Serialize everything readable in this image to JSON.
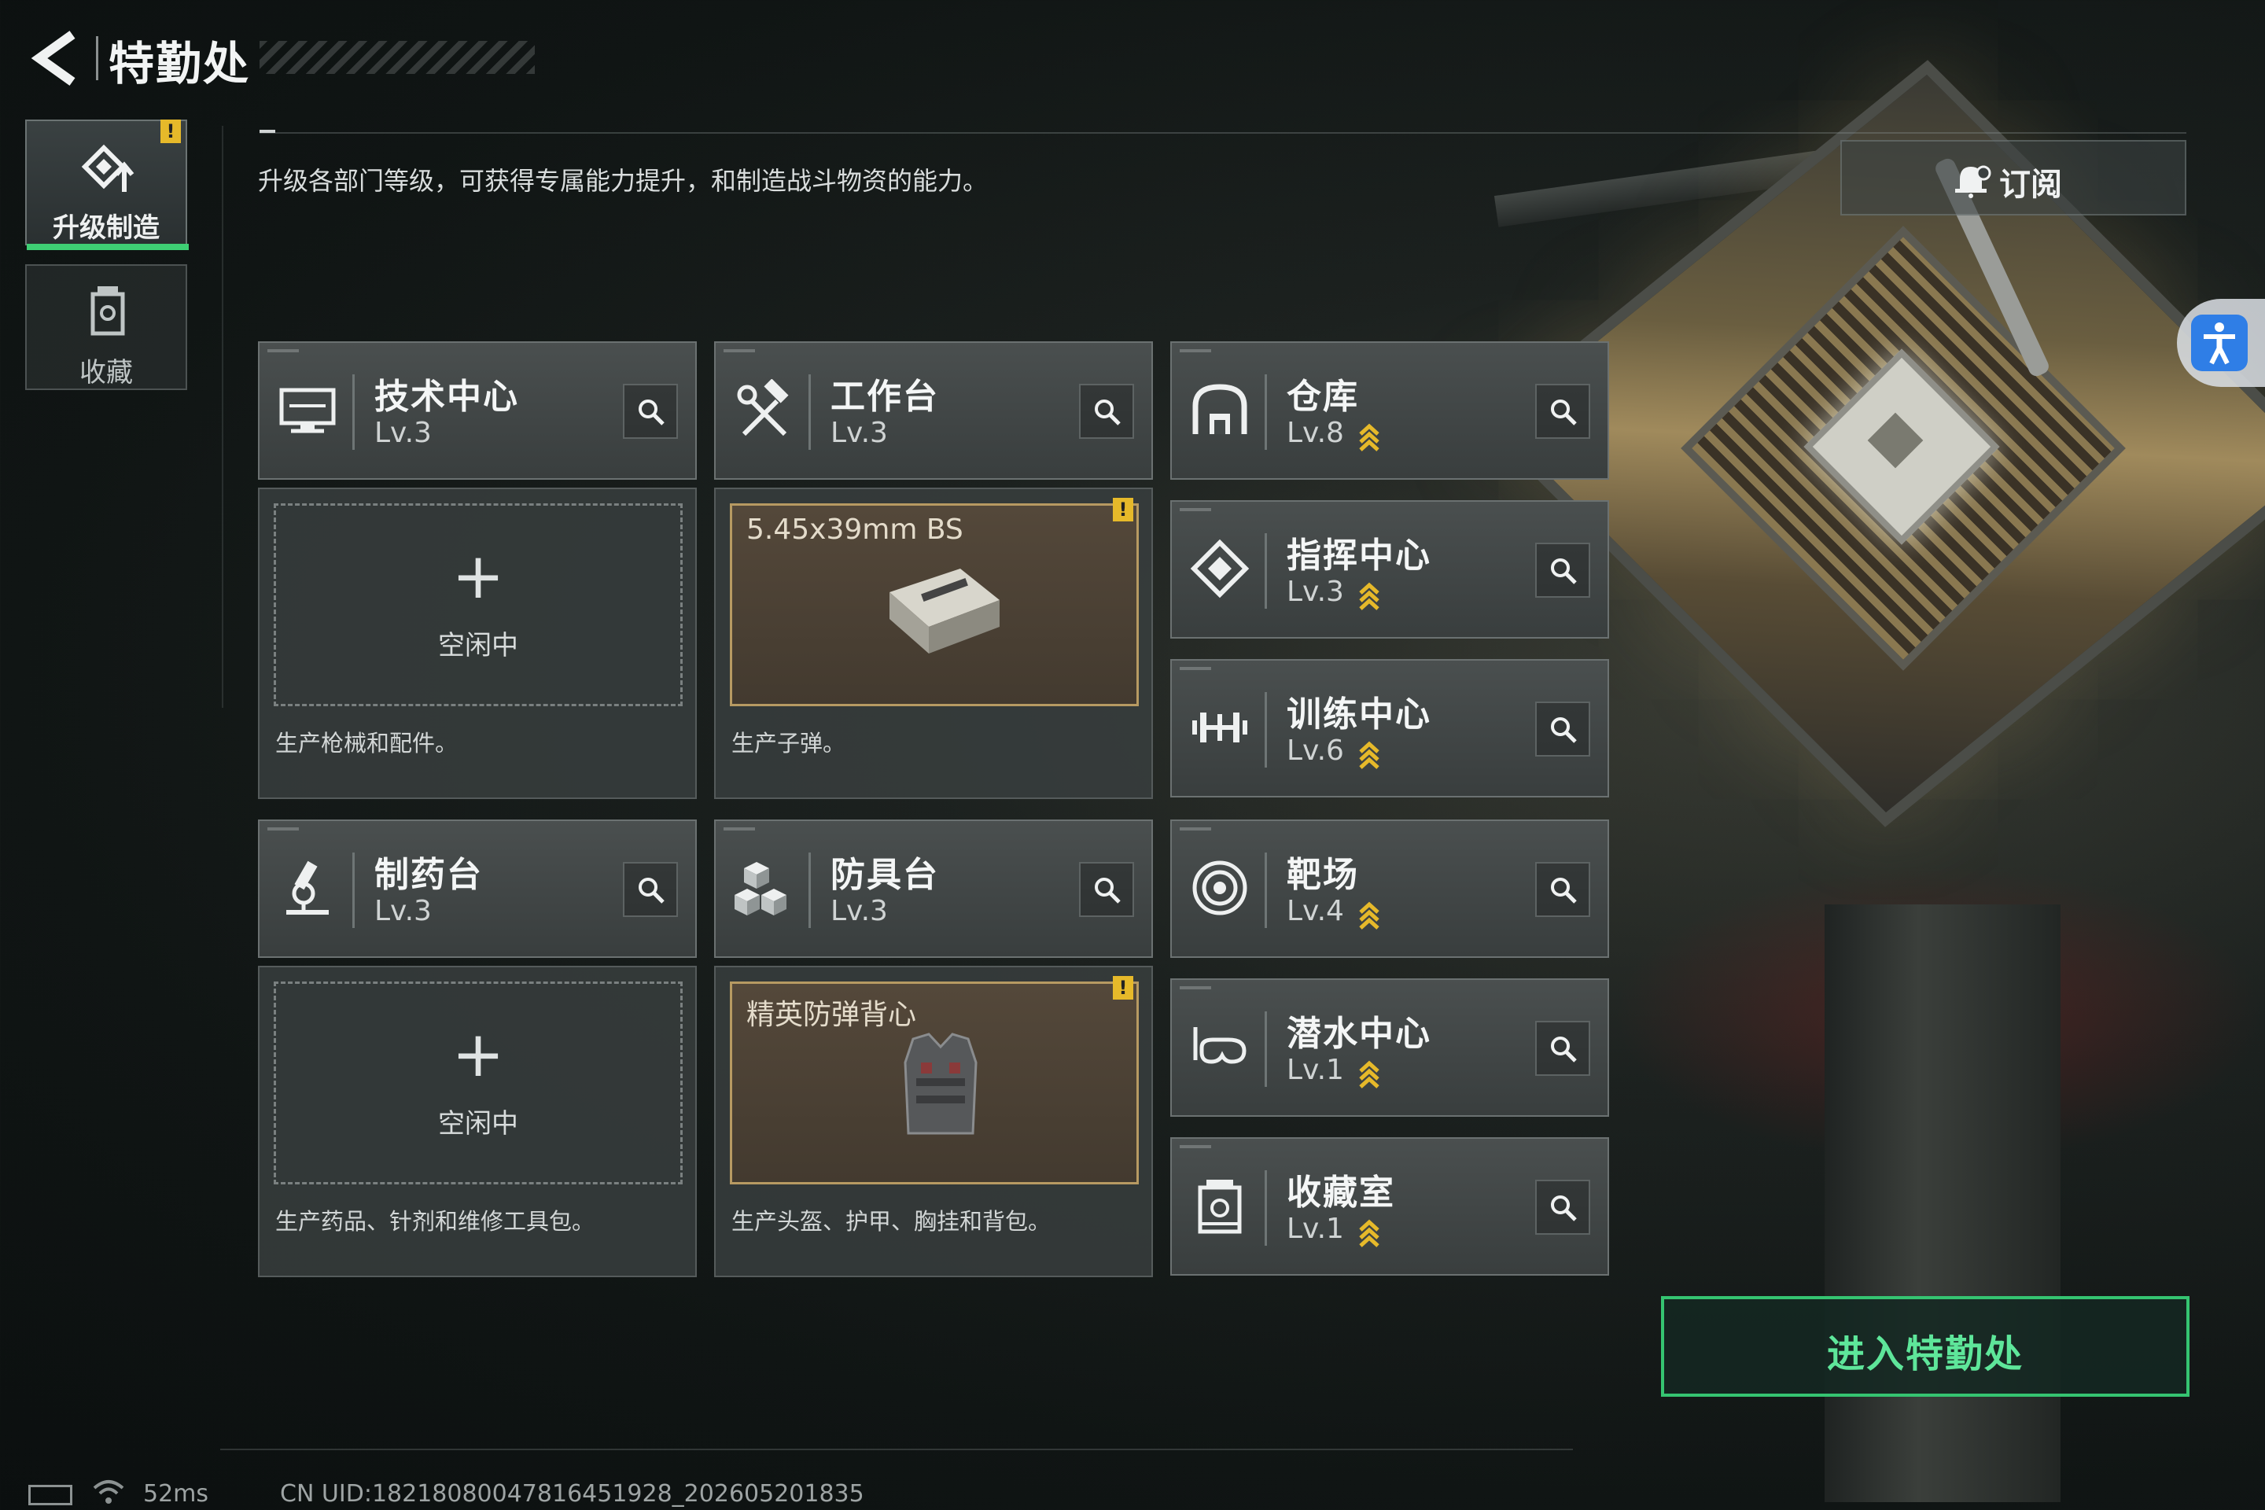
{
  "header": {
    "title": "特勤处",
    "description": "升级各部门等级，可获得专属能力提升，和制造战斗物资的能力。"
  },
  "sidebar": {
    "tabs": [
      {
        "label": "升级制造",
        "active": true,
        "warning": "!"
      },
      {
        "label": "收藏",
        "active": false
      }
    ]
  },
  "subscribe": {
    "label": "订阅"
  },
  "facilities": [
    {
      "name": "技术中心",
      "level": "Lv.3",
      "upgradable": false,
      "icon": "monitor-icon"
    },
    {
      "name": "工作台",
      "level": "Lv.3",
      "upgradable": false,
      "icon": "hammer-wrench-icon"
    },
    {
      "name": "仓库",
      "level": "Lv.8",
      "upgradable": true,
      "icon": "warehouse-icon"
    },
    {
      "name": "指挥中心",
      "level": "Lv.3",
      "upgradable": true,
      "icon": "command-diamond-icon"
    },
    {
      "name": "训练中心",
      "level": "Lv.6",
      "upgradable": true,
      "icon": "dumbbell-icon"
    },
    {
      "name": "制药台",
      "level": "Lv.3",
      "upgradable": false,
      "icon": "microscope-icon"
    },
    {
      "name": "防具台",
      "level": "Lv.3",
      "upgradable": false,
      "icon": "cubes-icon"
    },
    {
      "name": "靶场",
      "level": "Lv.4",
      "upgradable": true,
      "icon": "target-icon"
    },
    {
      "name": "潜水中心",
      "level": "Lv.1",
      "upgradable": true,
      "icon": "diving-mask-icon"
    },
    {
      "name": "收藏室",
      "level": "Lv.1",
      "upgradable": true,
      "icon": "collection-icon"
    }
  ],
  "production": [
    {
      "status": "空闲中",
      "plus": "+",
      "desc": "生产枪械和配件。"
    },
    {
      "item": "5.45x39mm BS",
      "warning": "!",
      "desc": "生产子弹。"
    },
    {
      "status": "空闲中",
      "plus": "+",
      "desc": "生产药品、针剂和维修工具包。"
    },
    {
      "item": "精英防弹背心",
      "warning": "!",
      "desc": "生产头盔、护甲、胸挂和背包。"
    }
  ],
  "enter_button": {
    "label": "进入特勤处"
  },
  "status_bar": {
    "ping": "52ms",
    "uid": "CN UID:18218080047816451928_202605201835"
  },
  "colors": {
    "accent_green": "#3ecf74",
    "upgrade_gold": "#e6b92a",
    "busy_border": "#b79a62"
  }
}
